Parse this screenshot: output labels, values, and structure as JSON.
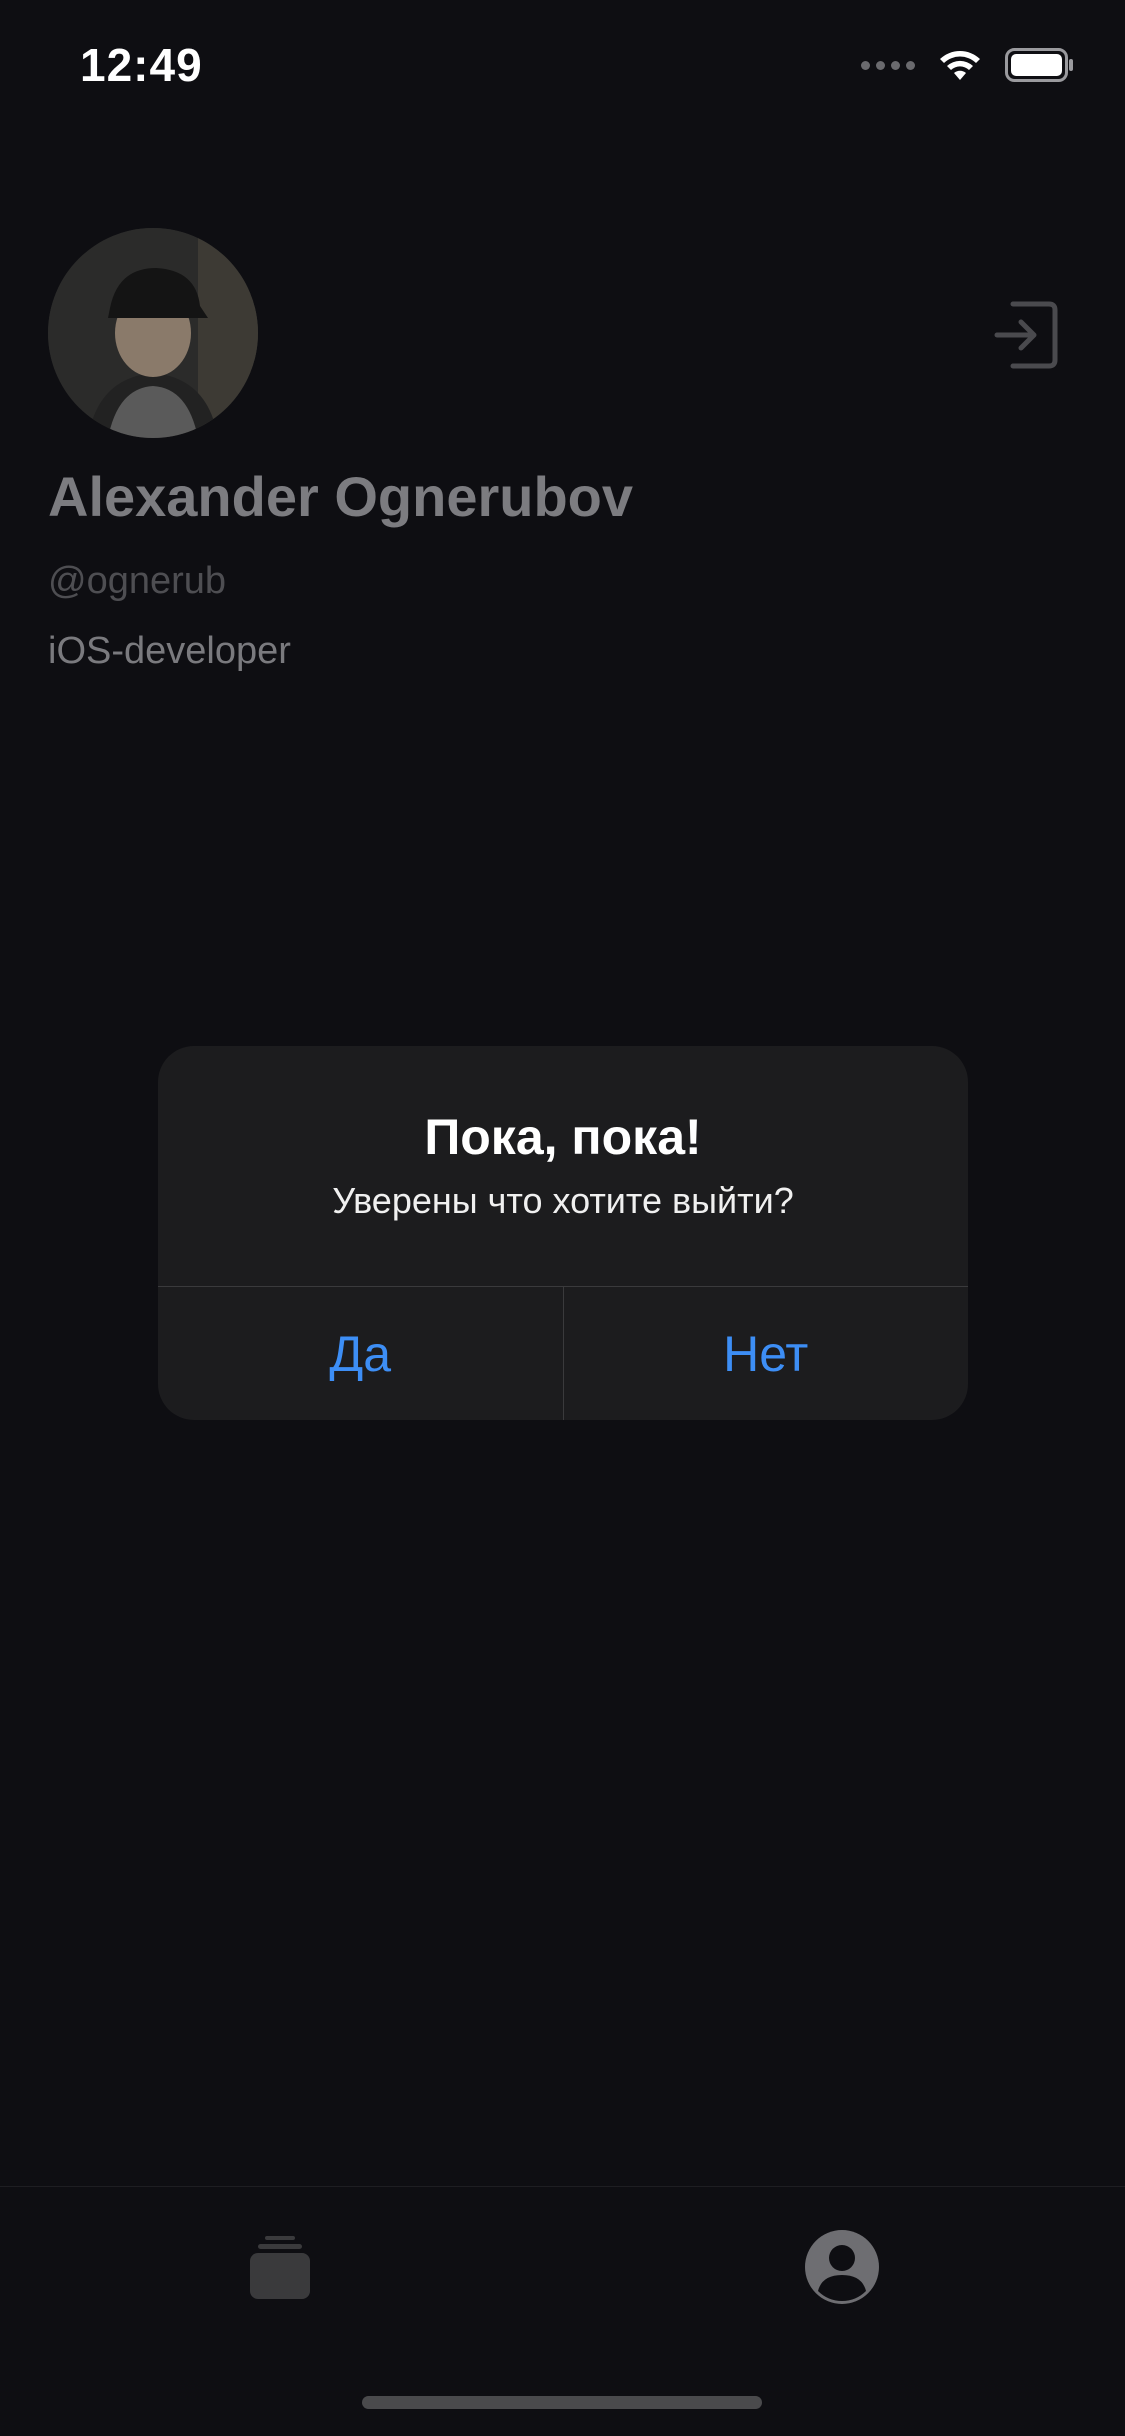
{
  "status_bar": {
    "time": "12:49"
  },
  "profile": {
    "name": "Alexander Ognerubov",
    "handle": "@ognerub",
    "role": "iOS-developer",
    "avatar_icon": "user-photo",
    "logout_icon": "logout-icon"
  },
  "alert": {
    "title": "Пока, пока!",
    "message": "Уверены что хотите выйти?",
    "confirm_label": "Да",
    "cancel_label": "Нет"
  },
  "tab_bar": {
    "tabs": [
      {
        "icon": "feed-stack-icon",
        "selected": false
      },
      {
        "icon": "person-circle-icon",
        "selected": true
      }
    ]
  },
  "colors": {
    "background": "#0e0e12",
    "alert_background": "#1c1c1e",
    "accent_blue": "#3d8ef5"
  }
}
